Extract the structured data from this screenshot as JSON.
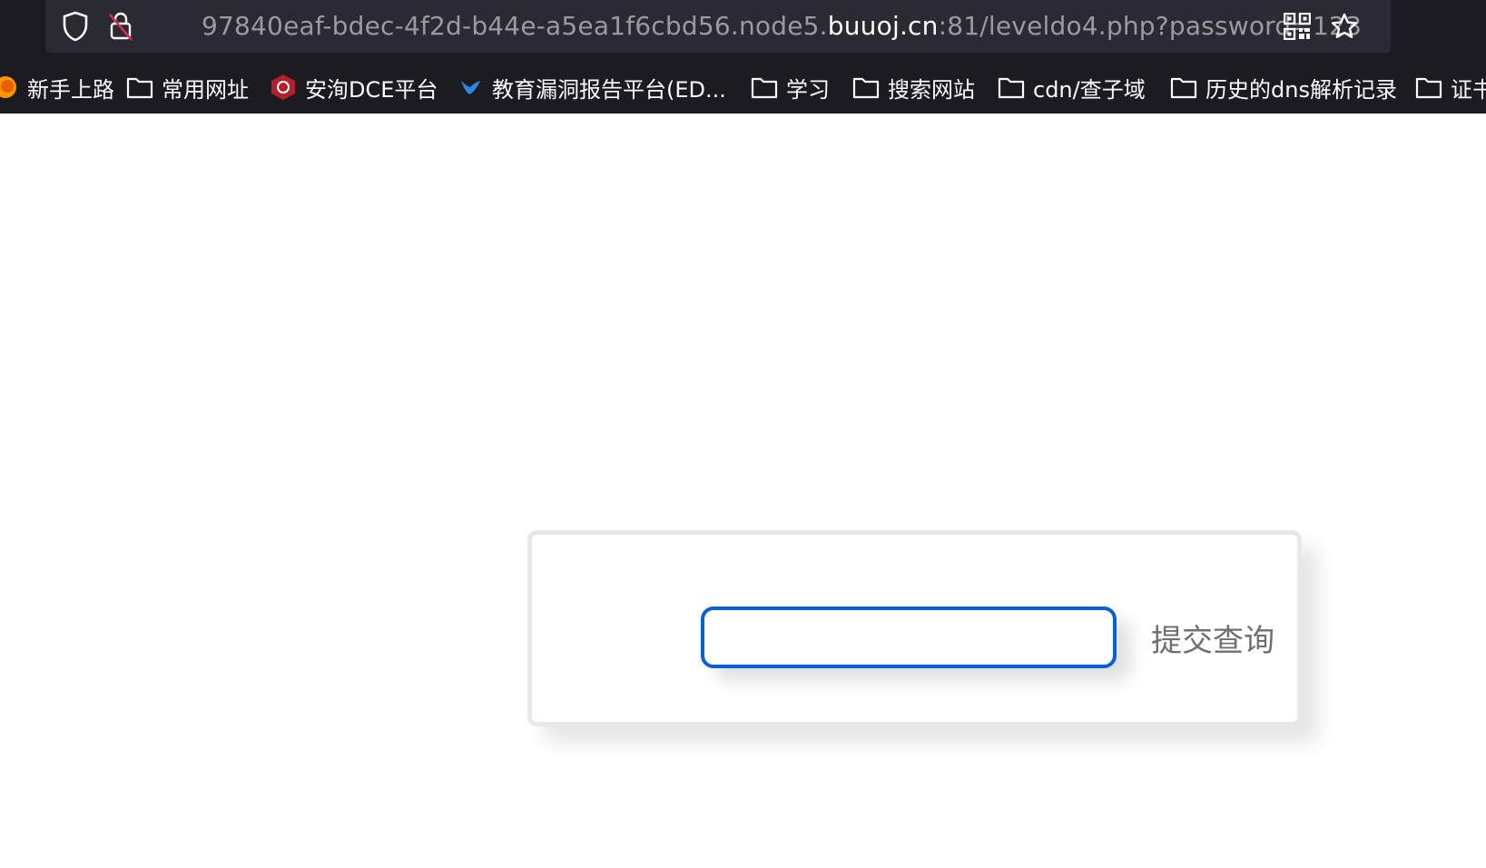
{
  "browser": {
    "url": {
      "prefix": "97840eaf-bdec-4f2d-b44e-a5ea1f6cbd56.node5.",
      "host": "buuoj.cn",
      "suffix": ":81/leveldo4.php?password=123"
    },
    "icons": {
      "shield": "shield-icon",
      "lock": "insecure-lock-icon",
      "qr": "qr-code-icon",
      "star": "bookmark-star-icon"
    }
  },
  "bookmarks": [
    {
      "label": "新手上路",
      "icon": "firefox-icon"
    },
    {
      "label": "常用网址",
      "icon": "folder-icon"
    },
    {
      "label": "安洵DCE平台",
      "icon": "site-logo-icon"
    },
    {
      "label": "教育漏洞报告平台(ED...",
      "icon": "bird-logo-icon"
    },
    {
      "label": "学习",
      "icon": "folder-icon"
    },
    {
      "label": "搜索网站",
      "icon": "folder-icon"
    },
    {
      "label": "cdn/查子域",
      "icon": "folder-icon"
    },
    {
      "label": "历史的dns解析记录",
      "icon": "folder-icon"
    },
    {
      "label": "证书",
      "icon": "folder-icon"
    }
  ],
  "form": {
    "input_value": "",
    "submit_label": "提交查询"
  },
  "colors": {
    "chrome_bg": "#1c1b22",
    "focus_ring": "#0a5fd1"
  }
}
